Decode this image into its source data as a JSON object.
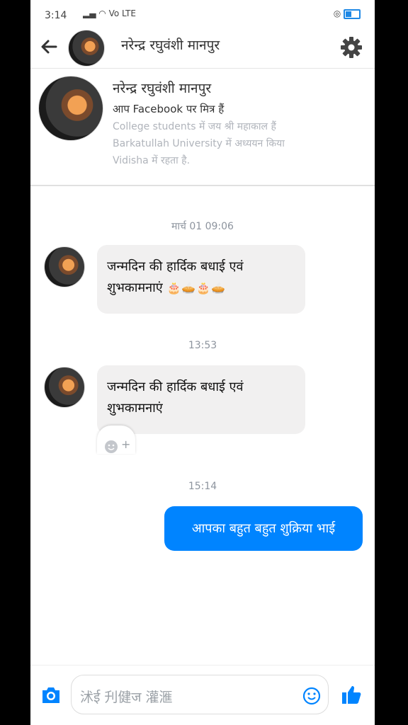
{
  "status_bar": {
    "time": "3:14",
    "network": "Vo LTE"
  },
  "header": {
    "title": "नरेन्द्र रघुवंशी मानपुर"
  },
  "profile": {
    "name": "नरेन्द्र रघुवंशी मानपुर",
    "friend_line": "आप Facebook पर मित्र हैं",
    "details": [
      "College students में जय श्री महाकाल हैं",
      "Barkatullah University में अध्ययन किया",
      "Vidisha में रहता है."
    ]
  },
  "messages": [
    {
      "timestamp": "मार्च 01 09:06",
      "text": "जन्मदिन की हार्दिक बधाई एवं",
      "text2": "शुभकामनाएं",
      "emojis": "🎂🥧🎂🥧"
    },
    {
      "timestamp": "13:53",
      "text": "जन्मदिन की हार्दिक बधाई एवं",
      "text2": "शुभकामनाएं"
    },
    {
      "timestamp": "15:14",
      "text": "आपका बहुत बहुत शुक्रिया भाई"
    }
  ],
  "reaction": {
    "plus": "+"
  },
  "composer": {
    "placeholder": "沭ई 刋健ज 灌滙"
  },
  "colors": {
    "accent": "#0084ff",
    "incoming_bubble": "#f1f0f0"
  }
}
